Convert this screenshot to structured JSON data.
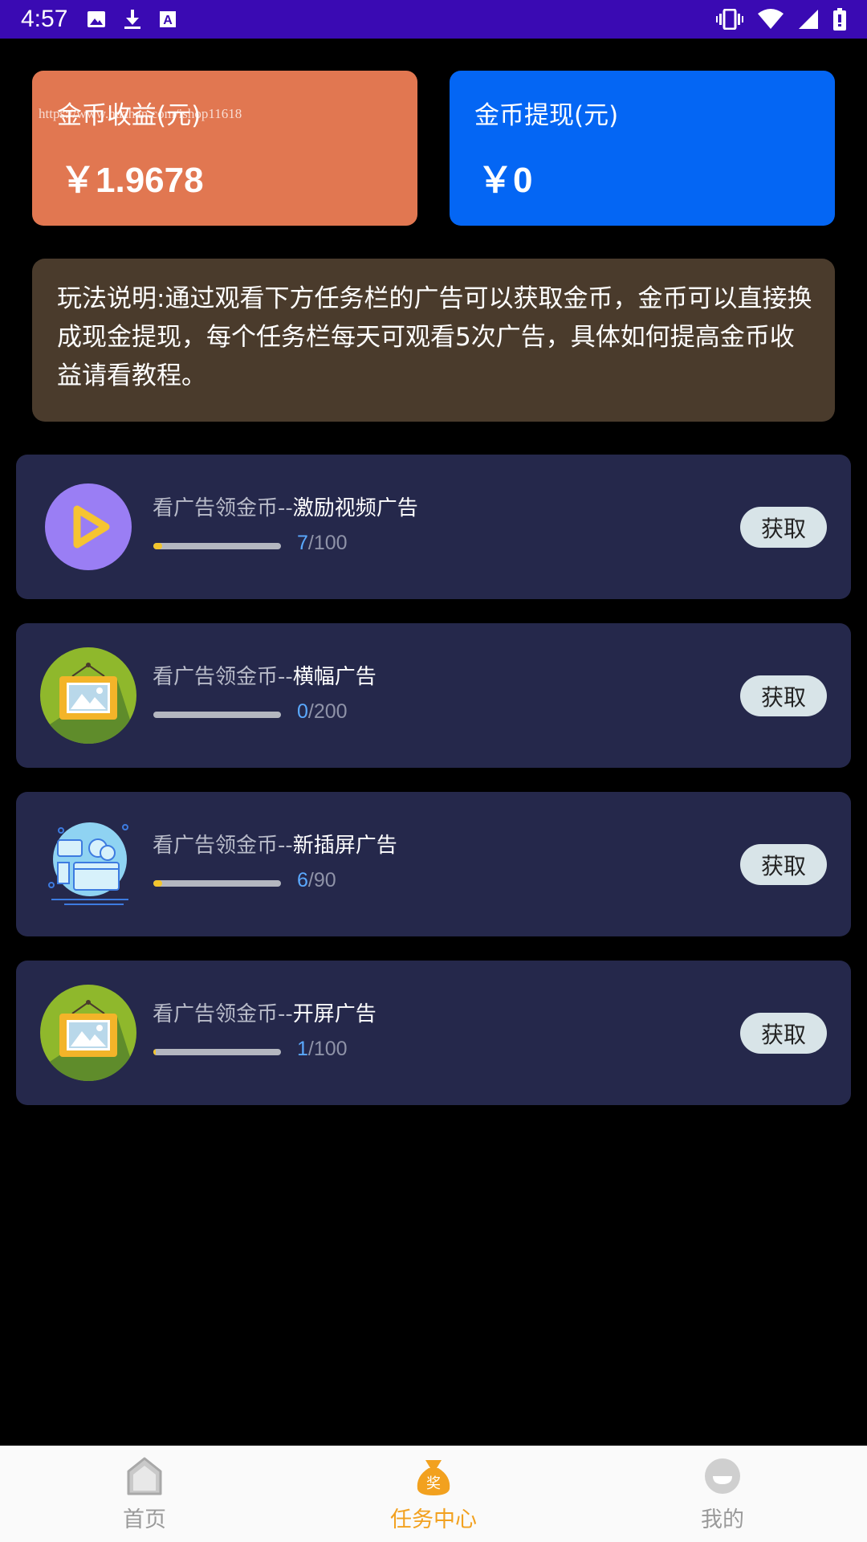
{
  "status_bar": {
    "time": "4:57",
    "left_icons": [
      "image-icon",
      "download-icon",
      "text-a-icon"
    ],
    "right_icons": [
      "vibrate-icon",
      "wifi-icon",
      "signal-icon",
      "battery-icon"
    ]
  },
  "earnings_card": {
    "label": "金币收益(元)",
    "amount": "￥1.9678",
    "watermark": "https://www.huzhan.com/ishop11618",
    "color": "#e17751"
  },
  "withdraw_card": {
    "label": "金币提现(元)",
    "amount": "￥0",
    "color": "#0466f4"
  },
  "instructions": {
    "text": "玩法说明:通过观看下方任务栏的广告可以获取金币，金币可以直接换成现金提现，每个任务栏每天可观看5次广告，具体如何提高金币收益请看教程。"
  },
  "tasks": [
    {
      "icon": "play-video-icon",
      "prefix": "看广告领金币--",
      "name": "激励视频广告",
      "current": "7",
      "total": "/100",
      "progress": 0.07,
      "button": "获取"
    },
    {
      "icon": "picture-frame-icon",
      "prefix": "看广告领金币--",
      "name": "横幅广告",
      "current": "0",
      "total": "/200",
      "progress": 0,
      "button": "获取"
    },
    {
      "icon": "interstitial-screen-icon",
      "prefix": "看广告领金币--",
      "name": "新插屏广告",
      "current": "6",
      "total": "/90",
      "progress": 0.0667,
      "button": "获取"
    },
    {
      "icon": "picture-frame-icon",
      "prefix": "看广告领金币--",
      "name": "开屏广告",
      "current": "1",
      "total": "/100",
      "progress": 0.01,
      "button": "获取"
    }
  ],
  "bottom_nav": {
    "items": [
      {
        "label": "首页",
        "icon": "home-icon",
        "active": false
      },
      {
        "label": "任务中心",
        "icon": "reward-bag-icon",
        "active": true
      },
      {
        "label": "我的",
        "icon": "profile-icon",
        "active": false
      }
    ],
    "active_color": "#f2a11f",
    "inactive_color": "#9a9a9a"
  }
}
